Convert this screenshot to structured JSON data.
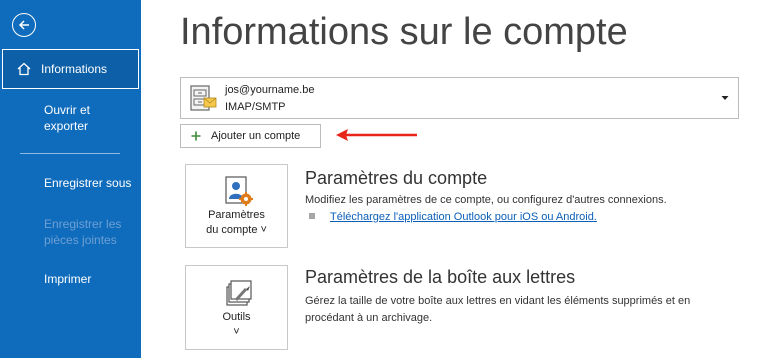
{
  "sidebar": {
    "back_icon": "back-arrow-icon",
    "items": [
      {
        "label": "Informations",
        "selected": true,
        "icon": "home-icon"
      },
      {
        "label": "Ouvrir et exporter"
      },
      {
        "label": "Enregistrer sous"
      },
      {
        "label": "Enregistrer les pièces jointes",
        "disabled": true
      },
      {
        "label": "Imprimer"
      }
    ]
  },
  "main": {
    "title": "Informations sur le compte",
    "account": {
      "email": "jos@yourname.be",
      "type": "IMAP/SMTP",
      "icon": "mail-account-icon"
    },
    "add_account_label": "Ajouter un compte",
    "sections": [
      {
        "tile_label_line1": "Paramètres",
        "tile_label_line2": "du compte ˅",
        "title": "Paramètres du compte",
        "description": "Modifiez les paramètres de ce compte, ou configurez d'autres connexions.",
        "link": "Téléchargez l'application Outlook pour iOS ou Android."
      },
      {
        "tile_label_line1": "Outils",
        "tile_label_line2": "˅",
        "title": "Paramètres de la boîte aux lettres",
        "description": "Gérez la taille de votre boîte aux lettres en vidant les éléments supprimés et en procédant à un archivage."
      }
    ]
  },
  "colors": {
    "sidebar": "#0f6cbd",
    "annotation_arrow": "#e8251b",
    "link": "#0b5fb8"
  }
}
